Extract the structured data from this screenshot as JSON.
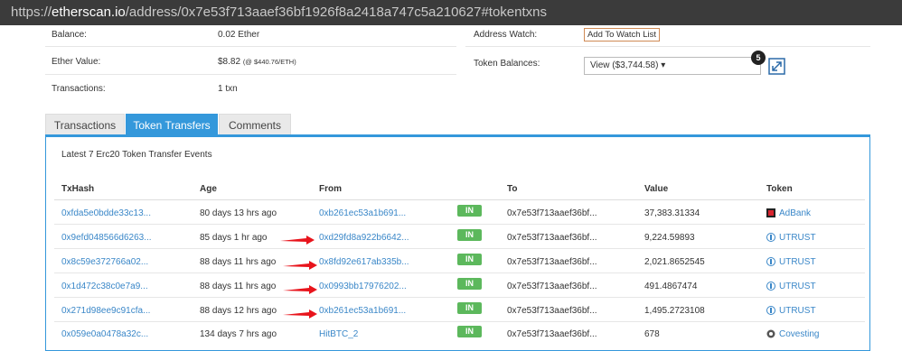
{
  "browser": {
    "url_scheme": "https://",
    "url_host": "etherscan.io",
    "url_path": "/address/0x7e53f713aaef36bf1926f8a2418a747c5a210627#tokentxns"
  },
  "overview": {
    "balance_label": "Balance:",
    "balance_value": "0.02 Ether",
    "ether_value_label": "Ether Value:",
    "ether_value": "$8.82",
    "ether_rate": "(@ $440.76/ETH)",
    "transactions_label": "Transactions:",
    "transactions_value": "1 txn",
    "address_watch_label": "Address Watch:",
    "add_watch_label": "Add To Watch List",
    "token_balances_label": "Token Balances:",
    "token_balances_value": "View ($3,744.58) ▾",
    "token_count": "5"
  },
  "tabs": [
    {
      "label": "Transactions",
      "active": false
    },
    {
      "label": "Token Transfers",
      "active": true
    },
    {
      "label": "Comments",
      "active": false
    }
  ],
  "summary": "Latest 7 Erc20 Token Transfer Events",
  "columns": [
    "TxHash",
    "Age",
    "From",
    "",
    "To",
    "Value",
    "Token"
  ],
  "rows": [
    {
      "txhash": "0xfda5e0bdde33c13...",
      "age": "80 days 13 hrs ago",
      "from": "0xb261ec53a1b691...",
      "dir": "IN",
      "to": "0x7e53f713aaef36bf...",
      "value": "37,383.31334",
      "token": "AdBank",
      "icon": "adbank-icon",
      "arrow": false
    },
    {
      "txhash": "0x9efd048566d6263...",
      "age": "85 days 1 hr ago",
      "from": "0xd29fd8a922b6642...",
      "dir": "IN",
      "to": "0x7e53f713aaef36bf...",
      "value": "9,224.59893",
      "token": "UTRUST",
      "icon": "utrust-icon",
      "arrow": true
    },
    {
      "txhash": "0x8c59e372766a02...",
      "age": "88 days 11 hrs ago",
      "from": "0x8fd92e617ab335b...",
      "dir": "IN",
      "to": "0x7e53f713aaef36bf...",
      "value": "2,021.8652545",
      "token": "UTRUST",
      "icon": "utrust-icon",
      "arrow": true
    },
    {
      "txhash": "0x1d472c38c0e7a9...",
      "age": "88 days 11 hrs ago",
      "from": "0x0993bb17976202...",
      "dir": "IN",
      "to": "0x7e53f713aaef36bf...",
      "value": "491.4867474",
      "token": "UTRUST",
      "icon": "utrust-icon",
      "arrow": true
    },
    {
      "txhash": "0x271d98ee9c91cfa...",
      "age": "88 days 12 hrs ago",
      "from": "0xb261ec53a1b691...",
      "dir": "IN",
      "to": "0x7e53f713aaef36bf...",
      "value": "1,495.2723108",
      "token": "UTRUST",
      "icon": "utrust-icon",
      "arrow": true
    },
    {
      "txhash": "0x059e0a0478a32c...",
      "age": "134 days 7 hrs ago",
      "from": "HitBTC_2",
      "dir": "IN",
      "to": "0x7e53f713aaef36bf...",
      "value": "678",
      "token": "Covesting",
      "icon": "covesting-icon",
      "arrow": false
    }
  ],
  "colors": {
    "accent": "#3498db",
    "link": "#3a87c8",
    "in_badge": "#5cb85c",
    "arrow": "#e8141c",
    "watch_border": "#d08a55"
  }
}
